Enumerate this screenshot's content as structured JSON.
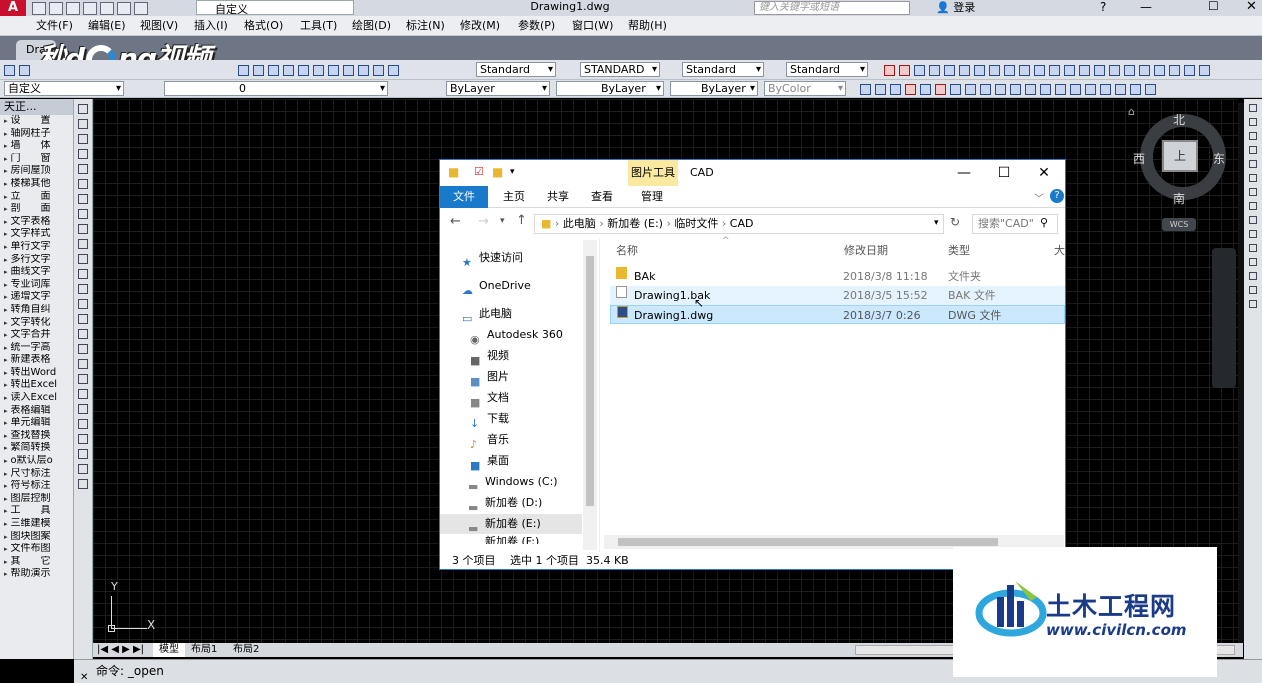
{
  "app": {
    "workspace": "自定义",
    "doc_title": "Drawing1.dwg",
    "search_placeholder": "键入关键字或短语",
    "login": "登录"
  },
  "menus": [
    "文件(F)",
    "编辑(E)",
    "视图(V)",
    "插入(I)",
    "格式(O)",
    "工具(T)",
    "绘图(D)",
    "标注(N)",
    "修改(M)",
    "参数(P)",
    "窗口(W)",
    "帮助(H)"
  ],
  "doc_tab": "Dra",
  "video_logo": {
    "text1": "秒",
    "text2": "ng视频",
    "text_d": "d"
  },
  "toolbar": {
    "text_style": "Standard",
    "dim_style": "STANDARD",
    "table_style": "Standard",
    "multileader_style": "Standard",
    "workspace2": "自定义",
    "layer": "0",
    "color": "ByLayer",
    "linetype": "ByLayer",
    "lineweight": "ByLayer",
    "plotstyle": "ByColor"
  },
  "left_panel": {
    "title": "天正...",
    "items": [
      "设　　置",
      "轴网柱子",
      "墙　　体",
      "门　　窗",
      "房间屋顶",
      "楼梯其他",
      "立　　面",
      "剖　　面",
      "文字表格",
      "文字样式",
      "单行文字",
      "多行文字",
      "曲线文字",
      "专业词库",
      "递增文字",
      "转角自纠",
      "文字转化",
      "文字合并",
      "统一字高",
      "新建表格",
      "转出Word",
      "转出Excel",
      "读入Excel",
      "表格编辑",
      "单元编辑",
      "查找替换",
      "繁简转换",
      "o默认层o",
      "尺寸标注",
      "符号标注",
      "图层控制",
      "工　　具",
      "三维建模",
      "图块图案",
      "文件布图",
      "其　　它",
      "帮助演示"
    ]
  },
  "viewcube": {
    "north": "北",
    "south": "南",
    "east": "东",
    "west": "西",
    "top": "上",
    "wcs": "WCS"
  },
  "ucs": {
    "x": "X",
    "y": "Y"
  },
  "layout_tabs": [
    "模型",
    "布局1",
    "布局2"
  ],
  "command": {
    "prompt": "命令: _open"
  },
  "explorer": {
    "context_tab": "图片工具",
    "folder_name": "CAD",
    "ribbon_tabs": [
      "文件",
      "主页",
      "共享",
      "查看",
      "管理"
    ],
    "path": [
      "此电脑",
      "新加卷 (E:)",
      "临时文件",
      "CAD"
    ],
    "search_placeholder": "搜索\"CAD\"",
    "nav": [
      "快速访问",
      "OneDrive",
      "此电脑",
      "Autodesk 360",
      "视频",
      "图片",
      "文档",
      "下载",
      "音乐",
      "桌面",
      "Windows (C:)",
      "新加卷 (D:)",
      "新加卷 (E:)",
      "新加卷 (F:)"
    ],
    "columns": [
      "名称",
      "修改日期",
      "类型",
      "大小"
    ],
    "files": [
      {
        "name": "BAk",
        "date": "2018/3/8 11:18",
        "type": "文件夹"
      },
      {
        "name": "Drawing1.bak",
        "date": "2018/3/5 15:52",
        "type": "BAK 文件"
      },
      {
        "name": "Drawing1.dwg",
        "date": "2018/3/7 0:26",
        "type": "DWG 文件"
      }
    ],
    "status": {
      "count": "3 个项目",
      "selected": "选中 1 个项目  35.4 KB"
    }
  },
  "watermark": {
    "title": "土木工程网",
    "url": "www.civilcn.com"
  },
  "colors": {
    "accent": "#1979ca",
    "selection": "#cce8ff",
    "canvas": "#000000"
  }
}
